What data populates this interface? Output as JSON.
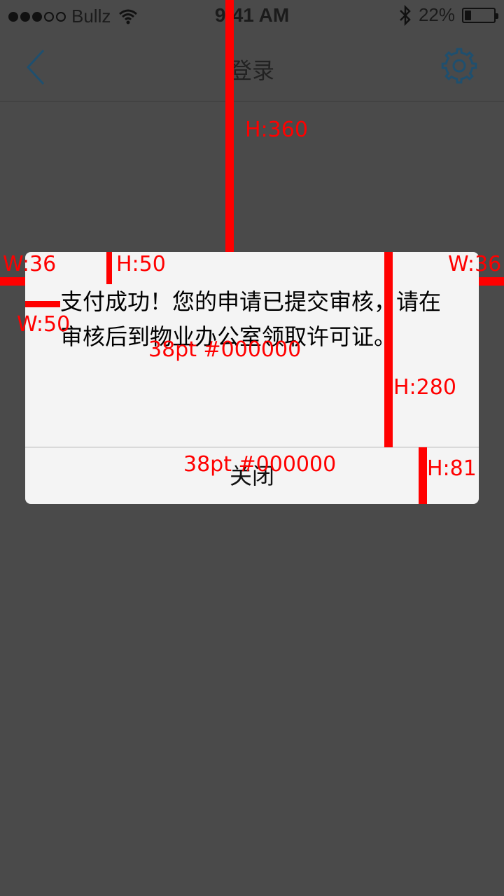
{
  "status_bar": {
    "carrier": "Bullz",
    "time": "9:41 AM",
    "battery_percent_text": "22%",
    "battery_level": 0.22,
    "signal_filled": 3,
    "signal_total": 5
  },
  "nav": {
    "title": "登录",
    "back_icon": "chevron-left-icon",
    "settings_icon": "gear-icon",
    "icon_color": "#1f4f6e"
  },
  "dialog": {
    "message": "支付成功！您的申请已提交审核，请在审核后到物业办公室领取许可证。",
    "close_label": "关闭",
    "background": "#f4f4f4"
  },
  "annotations": {
    "h_360": "H:360",
    "w_36_left": "W:36",
    "w_36_right": "W:36",
    "h_50": "H:50",
    "w_50": "W:50",
    "font_msg": "38pt #000000",
    "h_280": "H:280",
    "font_btn": "38pt #000000",
    "h_81": "H:81",
    "color": "#ff0000"
  }
}
